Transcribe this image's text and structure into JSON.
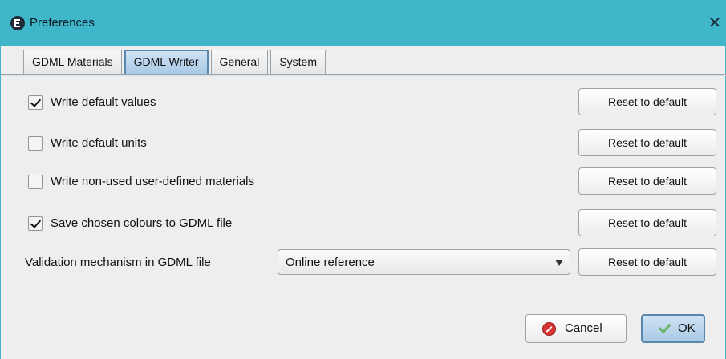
{
  "window": {
    "title": "Preferences",
    "close_glyph": "✕"
  },
  "tabs": [
    {
      "label": "GDML Materials",
      "active": false
    },
    {
      "label": "GDML Writer",
      "active": true
    },
    {
      "label": "General",
      "active": false
    },
    {
      "label": "System",
      "active": false
    }
  ],
  "settings": [
    {
      "label": "Write default values",
      "checked": true,
      "reset_label": "Reset to default"
    },
    {
      "label": "Write default units",
      "checked": false,
      "reset_label": "Reset to default"
    },
    {
      "label": "Write non-used user-defined materials",
      "checked": false,
      "reset_label": "Reset to default"
    },
    {
      "label": "Save chosen colours to GDML file",
      "checked": true,
      "reset_label": "Reset to default"
    }
  ],
  "validation": {
    "label": "Validation mechanism in GDML file",
    "selected": "Online reference",
    "reset_label": "Reset to default"
  },
  "footer": {
    "cancel_label": "Cancel",
    "ok_label": "OK"
  },
  "colors": {
    "titlebar": "#3fb6c9",
    "active_tab": "#a9c9e6",
    "cancel_icon": "#d73535",
    "ok_check": "#6bb56b"
  },
  "icons": {
    "app": "app-logo-icon",
    "close": "close-icon",
    "dropdown": "chevron-down-icon",
    "cancel": "cancel-icon",
    "ok": "checkmark-icon"
  }
}
